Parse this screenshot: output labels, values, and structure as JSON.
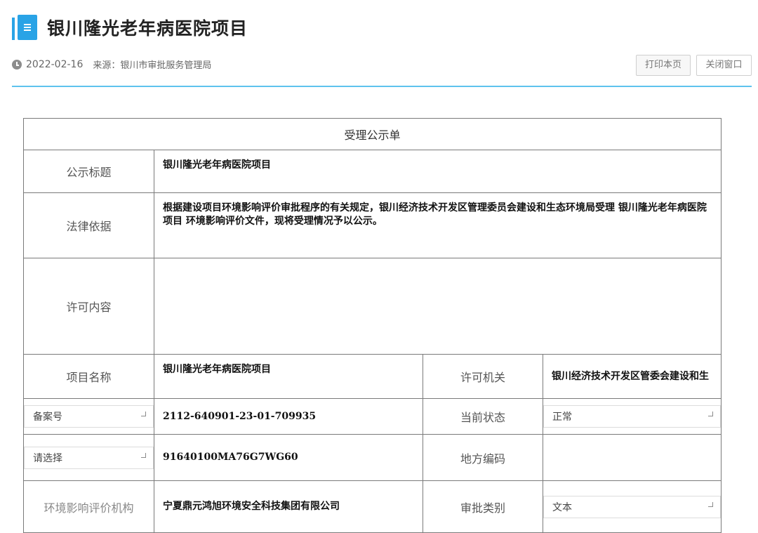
{
  "page": {
    "title": "银川隆光老年病医院项目",
    "date": "2022-02-16",
    "source": "来源：银川市审批服务管理局",
    "print_label": "打印本页",
    "close_label": "关闭窗口",
    "accent_color": "#29a3e6",
    "rule_color": "#5ec3ee"
  },
  "form": {
    "caption": "受理公示单",
    "notice_title_label": "公示标题",
    "notice_title_value": "银川隆光老年病医院项目",
    "legal_basis_label": "法律依据",
    "legal_basis_value": "根据建设项目环境影响评价审批程序的有关规定，银川经济技术开发区管理委员会建设和生态环境局受理 银川隆光老年病医院项目 环境影响评价文件，现将受理情况予以公示。",
    "permit_content_label": "许可内容",
    "permit_content_value": "",
    "project_name_label": "项目名称",
    "project_name_value": "银川隆光老年病医院项目",
    "permit_authority_label": "许可机关",
    "permit_authority_value": "银川经济技术开发区管委会建设和生",
    "record_select": "备案号",
    "record_value": "2112-640901-23-01-709935",
    "status_label": "当前状态",
    "status_select": "正常",
    "choose_select": "请选择",
    "choose_value": "91640100MA76G7WG60",
    "region_code_label": "地方编码",
    "region_code_value": "",
    "eia_agency_label": "环境影响评价机构",
    "eia_agency_value": "宁夏鼎元鸿旭环境安全科技集团有限公司",
    "approval_type_label": "审批类别",
    "approval_type_select": "文本"
  },
  "icons": {
    "title": "document-icon",
    "date": "clock-icon",
    "select": "chevron-down-icon"
  }
}
